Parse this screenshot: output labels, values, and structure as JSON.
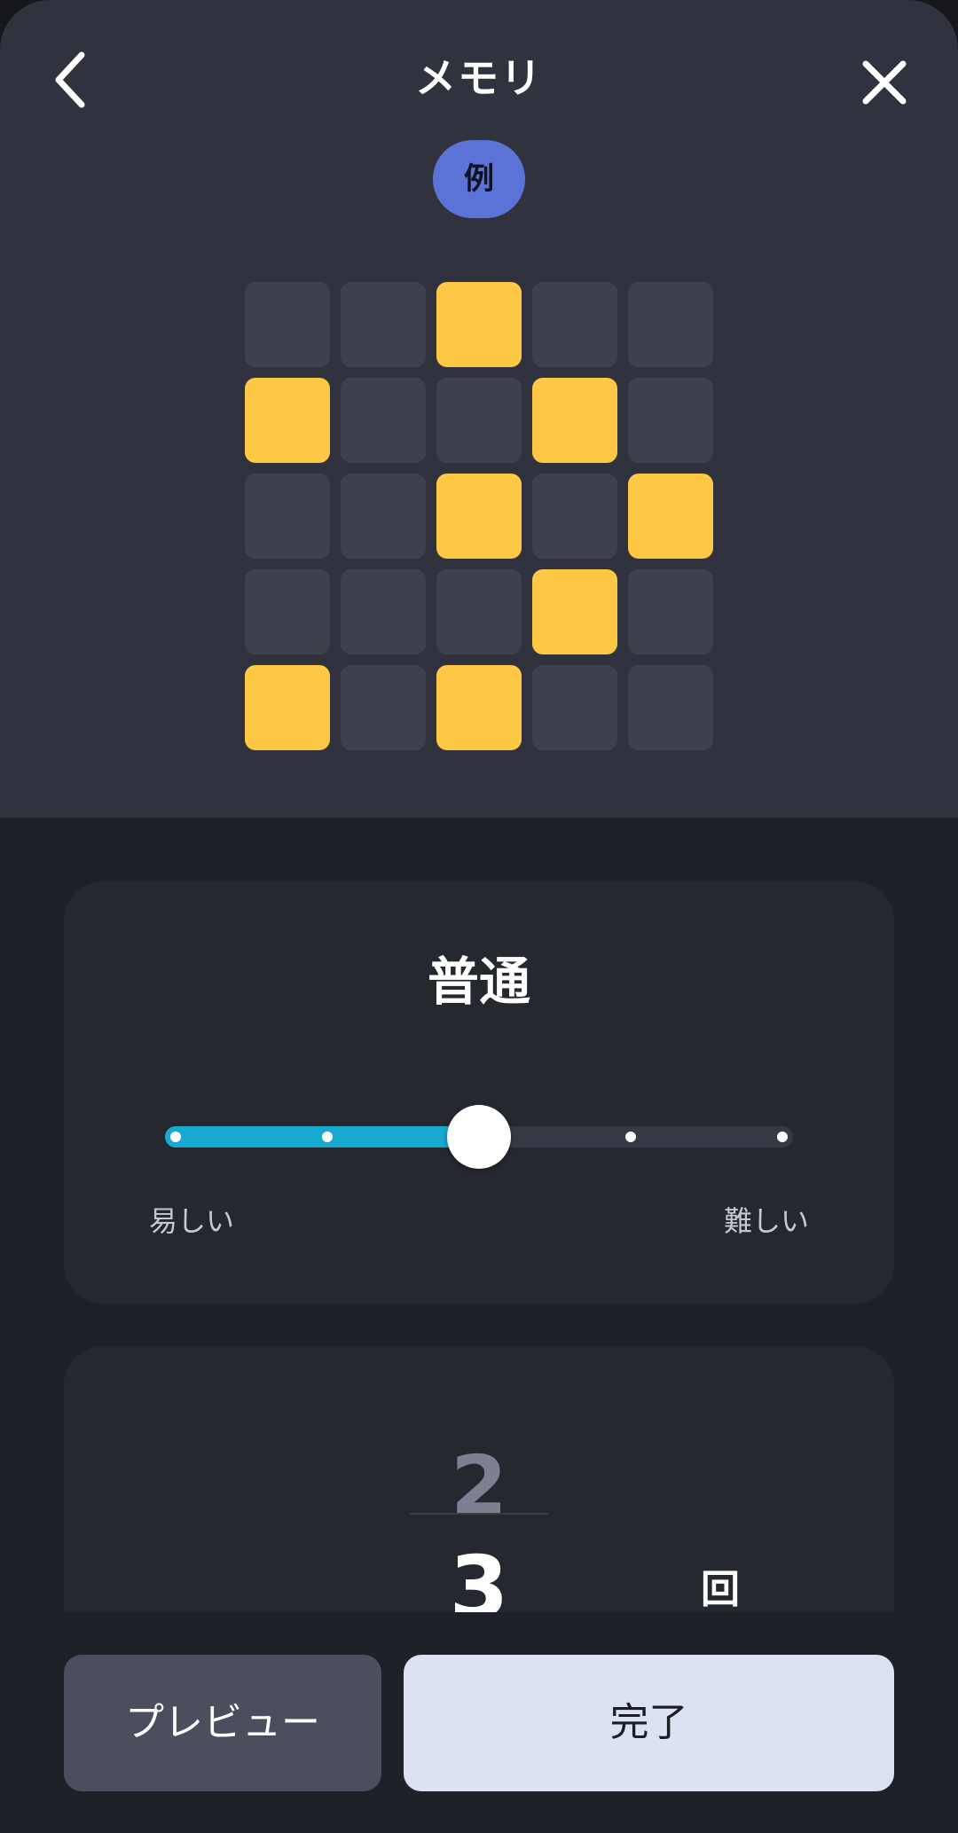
{
  "header": {
    "title": "メモリ",
    "example_badge": "例",
    "back_icon": "chevron-left-icon",
    "close_icon": "close-icon"
  },
  "grid": {
    "rows": 5,
    "cols": 5,
    "cells": [
      [
        0,
        0,
        1,
        0,
        0
      ],
      [
        1,
        0,
        0,
        1,
        0
      ],
      [
        0,
        0,
        1,
        0,
        1
      ],
      [
        0,
        0,
        0,
        1,
        0
      ],
      [
        1,
        0,
        1,
        0,
        0
      ]
    ],
    "on_color": "#fec844",
    "off_color": "#3e404b"
  },
  "difficulty": {
    "label": "普通",
    "min_label": "易しい",
    "max_label": "難しい",
    "steps": 5,
    "selected_step": 3,
    "accent": "#17a9d0"
  },
  "count_picker": {
    "prev_value": "2",
    "current_value": "3",
    "unit": "回"
  },
  "footer": {
    "preview_label": "プレビュー",
    "done_label": "完了"
  }
}
